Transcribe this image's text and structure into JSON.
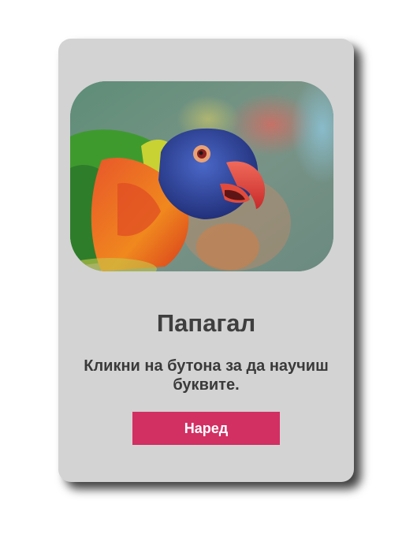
{
  "card": {
    "image_subject": "rainbow-lorikeet-parrot",
    "title": "Папагал",
    "description": "Кликни на бутона за да научиш буквите.",
    "next_button_label": "Наред"
  },
  "colors": {
    "card_background": "#d3d3d3",
    "button_background": "#d22f63",
    "button_text": "#ffffff",
    "title_text": "#3f3f3f"
  }
}
